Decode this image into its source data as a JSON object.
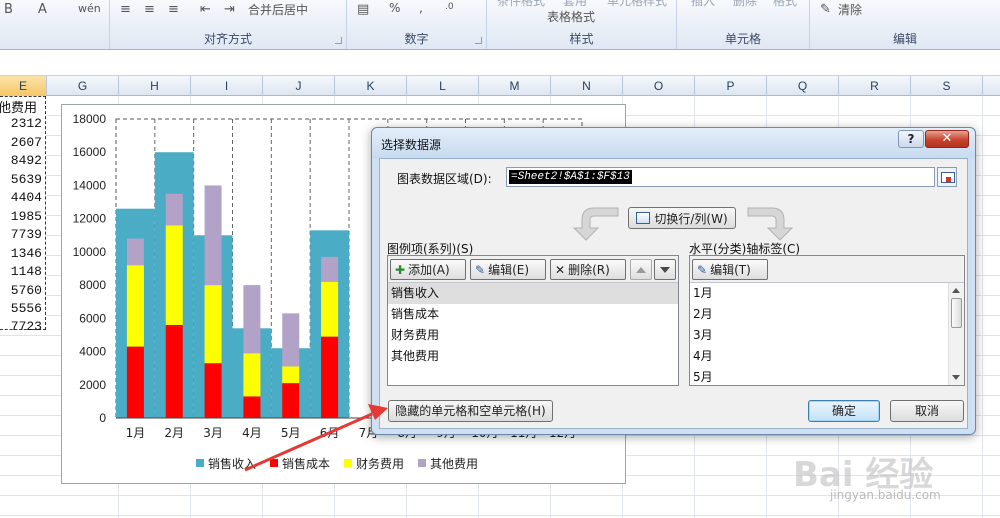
{
  "ribbon": {
    "groups": [
      {
        "name": "",
        "left": 0,
        "width": 110,
        "icons": [
          {
            "label": "B",
            "x": 4
          },
          {
            "label": "A",
            "x": 38
          },
          {
            "label": "wén",
            "x": 78
          }
        ]
      },
      {
        "name": "对齐方式",
        "left": 110,
        "width": 237,
        "buttons": [
          "合并后居中"
        ]
      },
      {
        "name": "数字",
        "left": 347,
        "width": 140,
        "buttons": [
          "%",
          ","
        ]
      },
      {
        "name": "样式",
        "left": 487,
        "width": 190,
        "buttons": [
          "条件格式",
          "套用",
          "表格格式",
          "单元格样式"
        ]
      },
      {
        "name": "单元格",
        "left": 677,
        "width": 133,
        "buttons": [
          "插入",
          "删除",
          "格式"
        ]
      },
      {
        "name": "编辑",
        "left": 810,
        "width": 190,
        "buttons": [
          "清除"
        ]
      }
    ]
  },
  "sheet": {
    "columns": [
      "E",
      "F",
      "G",
      "H",
      "I",
      "J",
      "K",
      "L",
      "M",
      "N",
      "O",
      "P",
      "Q",
      "R",
      "S"
    ],
    "active_column": "E",
    "column_e": {
      "header": "他费用",
      "values": [
        "2312",
        "2607",
        "8492",
        "5639",
        "4404",
        "1985",
        "7739",
        "1346",
        "1148",
        "5760",
        "5556",
        "7723"
      ]
    }
  },
  "chart_data": {
    "type": "bar",
    "categories": [
      "1月",
      "2月",
      "3月",
      "4月",
      "5月",
      "6月",
      "7月",
      "8月",
      "9月",
      "10月",
      "11月",
      "12月"
    ],
    "visible_categories": [
      "1月",
      "2月",
      "3月",
      "4月",
      "5月",
      "6月"
    ],
    "series": [
      {
        "name": "销售收入",
        "type": "column",
        "values": [
          12600,
          16000,
          11000,
          5400,
          4200,
          11300
        ],
        "color": "#4bacc6"
      },
      {
        "name": "销售成本",
        "type": "stacked",
        "values": [
          4300,
          5600,
          3300,
          1300,
          2100,
          4900
        ],
        "color": "#ff0000"
      },
      {
        "name": "财务费用",
        "type": "stacked",
        "values": [
          4900,
          6000,
          4700,
          2600,
          1000,
          3300
        ],
        "color": "#ffff00"
      },
      {
        "name": "其他费用",
        "type": "stacked",
        "values": [
          1600,
          1900,
          6000,
          4100,
          3200,
          1500
        ],
        "color": "#b2a2c7"
      }
    ],
    "yaxis": {
      "ticks": [
        "0",
        "2000",
        "4000",
        "6000",
        "8000",
        "10000",
        "12000",
        "14000",
        "16000",
        "18000"
      ],
      "ylim": [
        0,
        18000
      ]
    },
    "legend_position": "bottom",
    "gridlines": "dashed-vertical"
  },
  "dialog": {
    "title": "选择数据源",
    "help_label": "?",
    "close_label": "✕",
    "range_label": "图表数据区域(D):",
    "range_value": "=Sheet2!$A$1:$F$13",
    "switch_label": "切换行/列(W)",
    "series_header": "图例项(系列)(S)",
    "axis_header": "水平(分类)轴标签(C)",
    "series_toolbar": {
      "add": "添加(A)",
      "edit": "编辑(E)",
      "remove": "删除(R)"
    },
    "axis_toolbar": {
      "edit": "编辑(T)"
    },
    "series_items": [
      "销售收入",
      "销售成本",
      "财务费用",
      "其他费用"
    ],
    "selected_series": 0,
    "axis_items": [
      "1月",
      "2月",
      "3月",
      "4月",
      "5月"
    ],
    "hidden_cells_label": "隐藏的单元格和空单元格(H)",
    "ok_label": "确定",
    "cancel_label": "取消"
  },
  "annotation": {
    "arrow_color": "#e53935"
  },
  "watermark": {
    "text": "Bai 经验",
    "url": "jingyan.baidu.com"
  }
}
